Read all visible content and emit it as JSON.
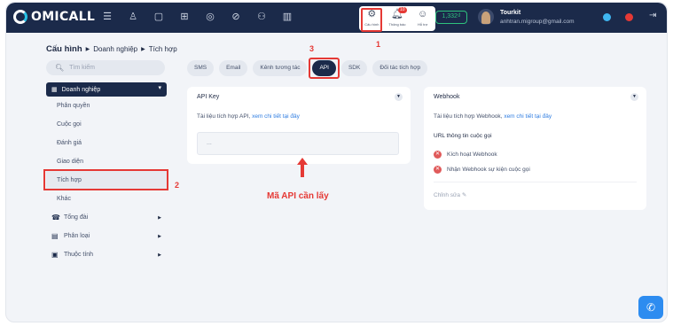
{
  "brand": {
    "logo_text": "OMICALL"
  },
  "topbar": {
    "nav_icons": [
      "menu-icon",
      "people-icon",
      "chat-icon",
      "grid-icon",
      "target-icon",
      "block-icon",
      "org-icon",
      "bar-chart-icon"
    ],
    "quick": [
      {
        "label": "Cấu hình",
        "icon": "gear-icon"
      },
      {
        "label": "Thông báo",
        "icon": "bell-icon",
        "badge": "10"
      },
      {
        "label": "Hỗ trợ",
        "icon": "support-icon"
      }
    ],
    "balance": "1,332₫",
    "user": {
      "name": "Tourkit",
      "email": "anhtran.migroup@gmail.com"
    },
    "status_colors": {
      "online": "#3fb6f0",
      "busy": "#e53935"
    }
  },
  "breadcrumb": {
    "root": "Cấu hình",
    "mid": "Doanh nghiệp",
    "leaf": "Tích hợp"
  },
  "search": {
    "placeholder": "Tìm kiếm"
  },
  "sidebar": {
    "header": "Doanh nghiệp",
    "sub_items": [
      "Phân quyền",
      "Cuộc gọi",
      "Đánh giá",
      "Giao diện",
      "Tích hợp",
      "Khác"
    ],
    "active": "Tích hợp",
    "groups": [
      "Tổng đài",
      "Phân loại",
      "Thuộc tính"
    ]
  },
  "tabs": [
    "SMS",
    "Email",
    "Kênh tương tác",
    "API",
    "SDK",
    "Đối tác tích hợp"
  ],
  "active_tab": "API",
  "api_card": {
    "title": "API Key",
    "doc_prefix": "Tài liệu tích hợp API,",
    "doc_link": "xem chi tiết tại đây",
    "key_value": "..."
  },
  "webhook_card": {
    "title": "Webhook",
    "doc_prefix": "Tài liệu tích hợp Webhook,",
    "doc_link": "xem chi tiết tại đây",
    "subtitle": "URL thông tin cuộc gọi",
    "options": [
      "Kích hoạt Webhook",
      "Nhận Webhook sự kiện cuộc gọi"
    ],
    "edit": "Chỉnh sửa"
  },
  "annotations": {
    "step1": "1",
    "step2": "2",
    "step3": "3",
    "note": "Mã API cần lấy",
    "color": "#e53935"
  },
  "accent": {
    "navy": "#1b2a4a",
    "link": "#2f7de1",
    "fab": "#2d8cf0"
  }
}
